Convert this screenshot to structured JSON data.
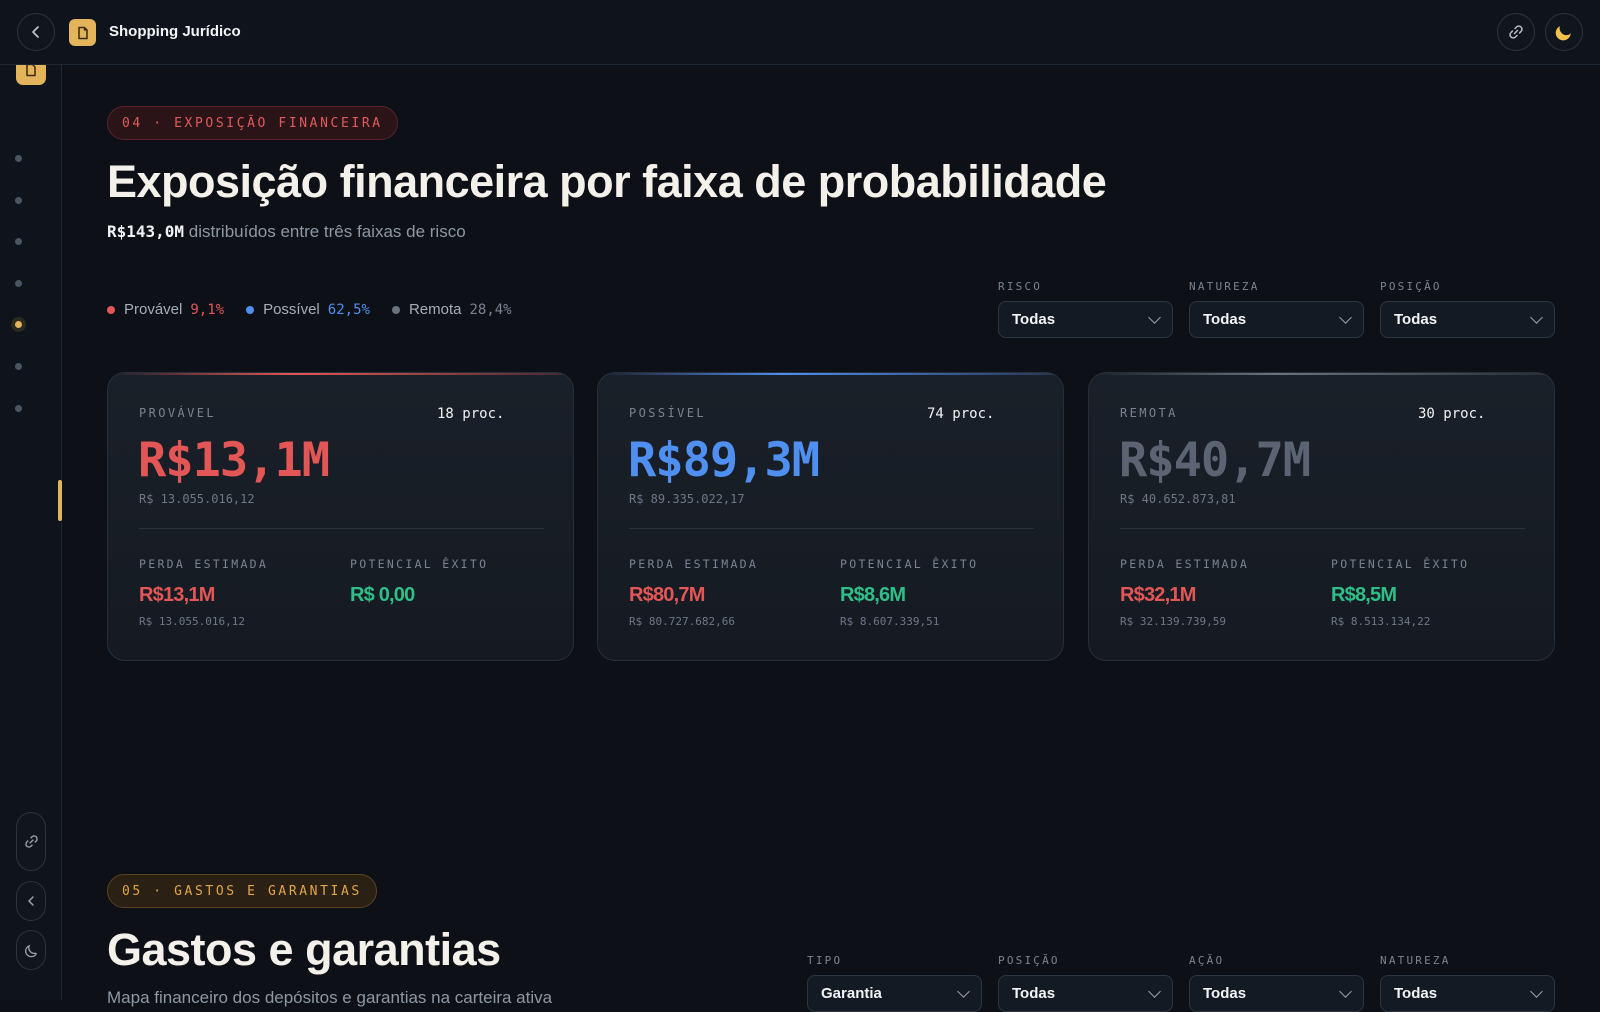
{
  "app": {
    "title": "Shopping Jurídico"
  },
  "section4": {
    "badge": "04 · EXPOSIÇÃO FINANCEIRA",
    "title": "Exposição financeira por faixa de probabilidade",
    "total": "R$143,0M",
    "subtitle_rest": "distribuídos entre três faixas de risco",
    "legend": [
      {
        "label": "Provável",
        "pct": "9,1%",
        "color": "#e35656"
      },
      {
        "label": "Possível",
        "pct": "62,5%",
        "color": "#4f8ff0"
      },
      {
        "label": "Remota",
        "pct": "28,4%",
        "color": "#6b7280"
      }
    ],
    "filters": [
      {
        "label": "RISCO",
        "value": "Todas"
      },
      {
        "label": "NATUREZA",
        "value": "Todas"
      },
      {
        "label": "POSIÇÃO",
        "value": "Todas"
      }
    ],
    "cards": [
      {
        "label": "PROVÁVEL",
        "count": "18 proc.",
        "big": "R$13,1M",
        "exact": "R$ 13.055.016,12",
        "loss_label": "PERDA ESTIMADA",
        "loss": "R$13,1M",
        "loss_exact": "R$ 13.055.016,12",
        "win_label": "POTENCIAL ÊXITO",
        "win": "R$ 0,00",
        "win_exact": "",
        "accent": "#e35656"
      },
      {
        "label": "POSSÍVEL",
        "count": "74 proc.",
        "big": "R$89,3M",
        "exact": "R$ 89.335.022,17",
        "loss_label": "PERDA ESTIMADA",
        "loss": "R$80,7M",
        "loss_exact": "R$ 80.727.682,66",
        "win_label": "POTENCIAL ÊXITO",
        "win": "R$8,6M",
        "win_exact": "R$ 8.607.339,51",
        "accent": "#4f8ff0"
      },
      {
        "label": "REMOTA",
        "count": "30 proc.",
        "big": "R$40,7M",
        "exact": "R$ 40.652.873,81",
        "loss_label": "PERDA ESTIMADA",
        "loss": "R$32,1M",
        "loss_exact": "R$ 32.139.739,59",
        "win_label": "POTENCIAL ÊXITO",
        "win": "R$8,5M",
        "win_exact": "R$ 8.513.134,22",
        "accent": "#5c6473"
      }
    ]
  },
  "section5": {
    "badge": "05 · GASTOS E GARANTIAS",
    "title": "Gastos e garantias",
    "subtitle": "Mapa financeiro dos depósitos e garantias na carteira ativa",
    "filters": [
      {
        "label": "TIPO",
        "value": "Garantia"
      },
      {
        "label": "POSIÇÃO",
        "value": "Todas"
      },
      {
        "label": "AÇÃO",
        "value": "Todas"
      },
      {
        "label": "NATUREZA",
        "value": "Todas"
      }
    ]
  },
  "icons": {
    "back": "chevron-left-icon",
    "logo": "document-icon",
    "link": "link-icon",
    "theme": "moon-icon"
  }
}
